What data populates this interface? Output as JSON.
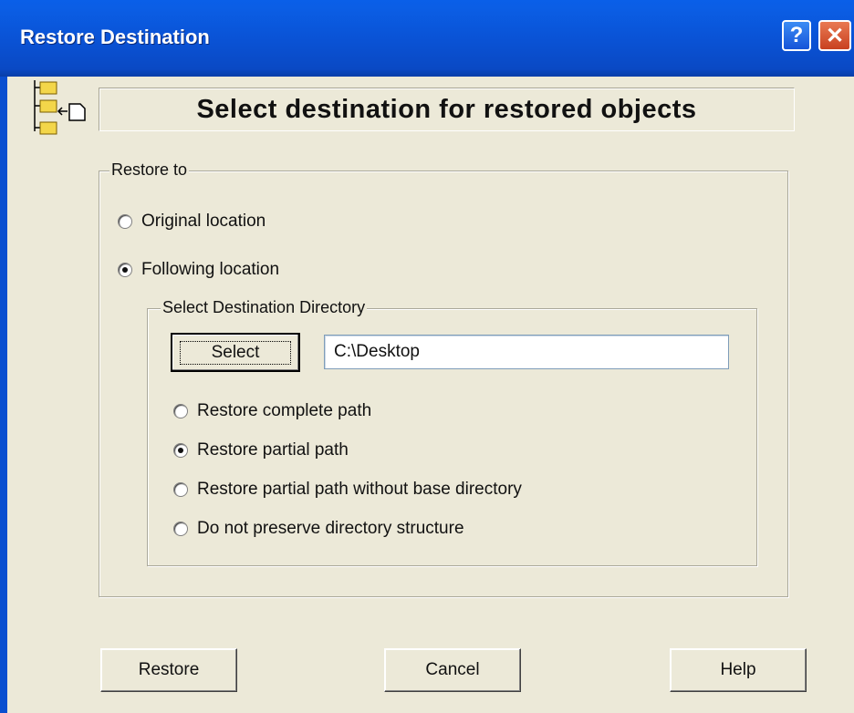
{
  "window": {
    "title": "Restore Destination",
    "help_button": "?",
    "close_button": "✕"
  },
  "header": {
    "title": "Select destination for restored objects",
    "icon": "folder-tree-restore-icon"
  },
  "restore_to": {
    "legend": "Restore to",
    "options": [
      {
        "label": "Original location",
        "checked": false
      },
      {
        "label": "Following location",
        "checked": true
      }
    ]
  },
  "destination": {
    "legend": "Select Destination Directory",
    "select_label": "Select",
    "path_value": "C:\\Desktop",
    "path_options": [
      {
        "label": "Restore complete path",
        "checked": false
      },
      {
        "label": "Restore partial path",
        "checked": true
      },
      {
        "label": "Restore partial path without base directory",
        "checked": false
      },
      {
        "label": "Do not preserve directory structure",
        "checked": false
      }
    ]
  },
  "footer": {
    "restore_label": "Restore",
    "cancel_label": "Cancel",
    "help_label": "Help"
  },
  "colors": {
    "titlebar": "#0a53d6",
    "dialog_bg": "#ece9d8"
  }
}
